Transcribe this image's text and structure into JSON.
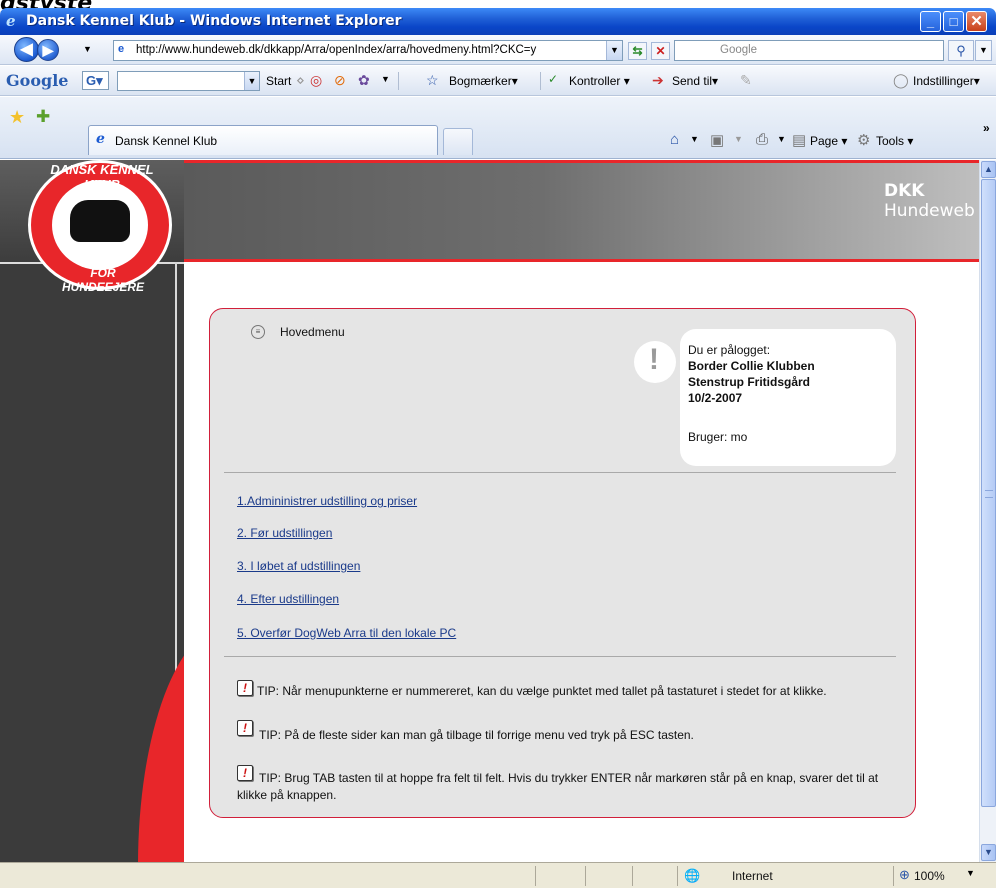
{
  "caption": "gstyste",
  "window": {
    "title": "Dansk Kennel Klub - Windows Internet Explorer"
  },
  "address_bar": {
    "url": "http://www.hundeweb.dk/dkkapp/Arra/openIndex/arra/hovedmeny.html?CKC=y",
    "search_placeholder": "Google"
  },
  "google_toolbar": {
    "logo": "Google",
    "g_button": "G",
    "start": "Start",
    "bookmarks": "Bogmærker",
    "check": "Kontroller",
    "send_to": "Send til",
    "settings": "Indstillinger"
  },
  "tabs": {
    "active_label": "Dansk Kennel Klub"
  },
  "command_bar": {
    "page": "Page",
    "tools": "Tools"
  },
  "site": {
    "title_bold": "DKK",
    "title_rest": "Hundeweb",
    "logo_top": "DANSK KENNEL KLUB",
    "logo_bottom": "FOR HUNDEEJERE"
  },
  "panel": {
    "menu_title": "Hovedmenu",
    "login": {
      "heading": "Du er pålogget:",
      "club": "Border Collie Klubben",
      "location": "Stenstrup Fritidsgård",
      "date": "10/2-2007",
      "user": "Bruger: mo"
    },
    "menu_items": [
      "1.Admininistrer udstilling og priser",
      "2. Før udstillingen",
      "3. I løbet af udstillingen",
      "4. Efter udstillingen",
      "5. Overfør DogWeb Arra til den lokale PC"
    ],
    "tips": [
      "TIP: Når menupunkterne er nummereret, kan du vælge punktet med tallet på tastaturet i stedet for at klikke.",
      "TIP: På de fleste sider kan man gå tilbage til forrige menu ved tryk på ESC tasten.",
      "TIP: Brug TAB tasten til at hoppe fra felt til felt. Hvis du trykker ENTER når markøren står på en knap, svarer det til at klikke på knappen."
    ]
  },
  "status_bar": {
    "zone": "Internet",
    "zoom": "100%"
  },
  "colors": {
    "accent_red": "#e8262a",
    "panel_border": "#d11f3a",
    "title_bar_blue": "#0a46c8",
    "link_blue": "#1a3a8a"
  }
}
